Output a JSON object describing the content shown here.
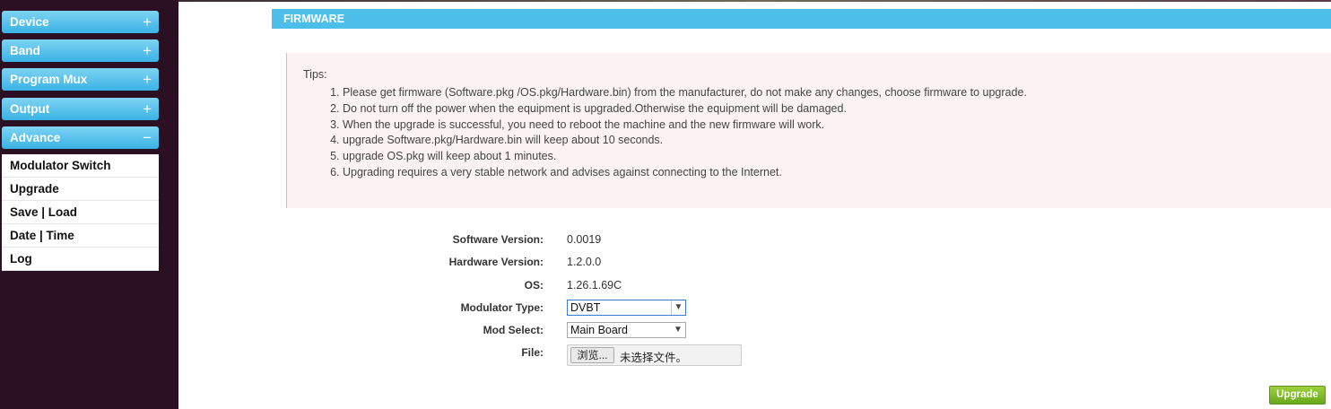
{
  "sidebar": {
    "sections": [
      {
        "label": "Device",
        "sign": "+"
      },
      {
        "label": "Band",
        "sign": "+"
      },
      {
        "label": "Program Mux",
        "sign": "+"
      },
      {
        "label": "Output",
        "sign": "+"
      },
      {
        "label": "Advance",
        "sign": "−"
      }
    ],
    "advance_items": [
      "Modulator Switch",
      "Upgrade",
      "Save | Load",
      "Date | Time",
      "Log"
    ]
  },
  "header": {
    "title": "FIRMWARE"
  },
  "tips": {
    "title": "Tips:",
    "items": [
      "Please get firmware (Software.pkg /OS.pkg/Hardware.bin) from the manufacturer, do not make any changes, choose firmware to upgrade.",
      "Do not turn off the power when the equipment is upgraded.Otherwise the equipment will be damaged.",
      "When the upgrade is successful, you need to reboot the machine and the new firmware will work.",
      "upgrade Software.pkg/Hardware.bin will keep about 10 seconds.",
      "upgrade OS.pkg will keep about 1 minutes.",
      "Upgrading requires a very stable network and advises against connecting to the Internet."
    ]
  },
  "form": {
    "software_version": {
      "label": "Software Version:",
      "value": "0.0019"
    },
    "hardware_version": {
      "label": "Hardware Version:",
      "value": "1.2.0.0"
    },
    "os": {
      "label": "OS:",
      "value": "1.26.1.69C"
    },
    "modulator_type": {
      "label": "Modulator Type:",
      "value": "DVBT"
    },
    "mod_select": {
      "label": "Mod Select:",
      "value": "Main Board"
    },
    "file": {
      "label": "File:",
      "button": "浏览...",
      "status": "未选择文件。"
    }
  },
  "upgrade_button": "Upgrade",
  "colors": {
    "header": "#4dbde9",
    "nav": "#39b3e6",
    "upgrade": "#7ab828",
    "background": "#2b0f22"
  }
}
